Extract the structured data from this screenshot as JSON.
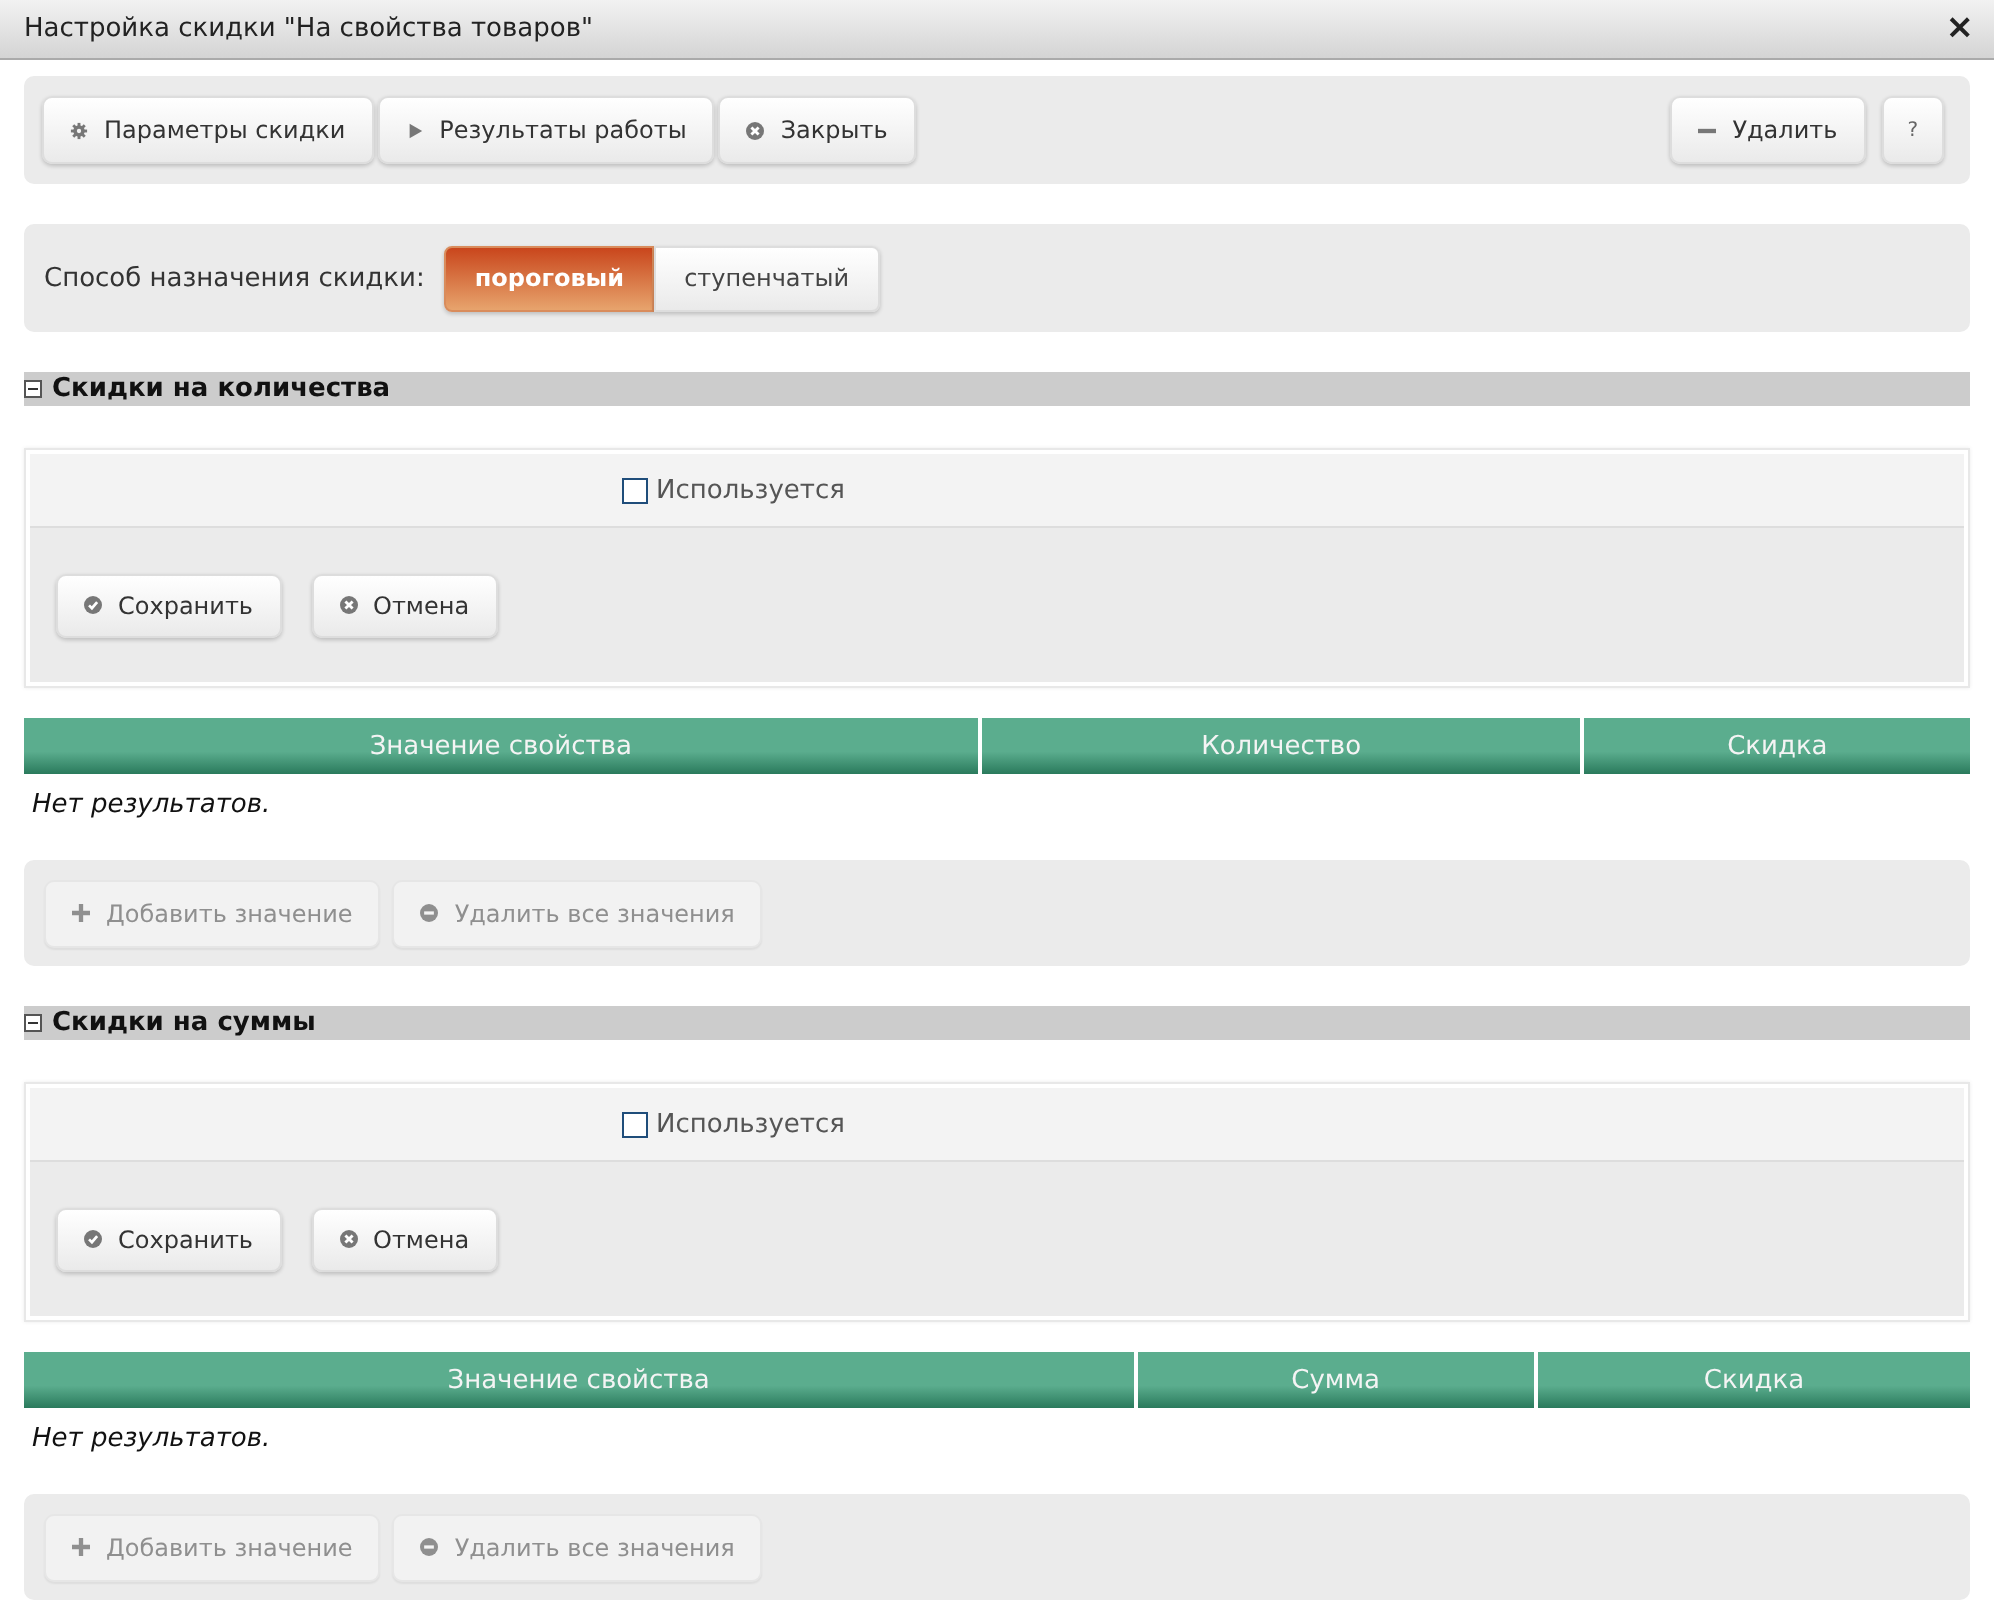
{
  "window": {
    "title": "Настройка скидки \"На свойства товаров\"",
    "close": "×"
  },
  "toolbar": {
    "left": [
      "Параметры скидки",
      "Результаты работы",
      "Закрыть"
    ],
    "right": [
      "Удалить",
      "?"
    ]
  },
  "mode": {
    "label": "Способ назначения скидки:",
    "options": [
      {
        "label": "пороговый",
        "selected": true
      },
      {
        "label": "ступенчатый",
        "selected": false
      }
    ]
  },
  "sections": [
    {
      "title": "Скидки на количества",
      "expanded": true,
      "used": {
        "label": "Используется",
        "checked": false
      },
      "form_buttons": [
        "Сохранить",
        "Отмена"
      ],
      "columns": [
        "Значение свойства",
        "Количество",
        "Скидка"
      ],
      "empty_text": "Нет результатов.",
      "actions": [
        {
          "label": "Добавить значение",
          "disabled": true
        },
        {
          "label": "Удалить все значения",
          "disabled": true
        }
      ]
    },
    {
      "title": "Скидки на суммы",
      "expanded": true,
      "used": {
        "label": "Используется",
        "checked": false
      },
      "form_buttons": [
        "Сохранить",
        "Отмена"
      ],
      "columns": [
        "Значение свойства",
        "Сумма",
        "Скидка"
      ],
      "empty_text": "Нет результатов.",
      "actions": [
        {
          "label": "Добавить значение",
          "disabled": true
        },
        {
          "label": "Удалить все значения",
          "disabled": true
        }
      ]
    }
  ]
}
